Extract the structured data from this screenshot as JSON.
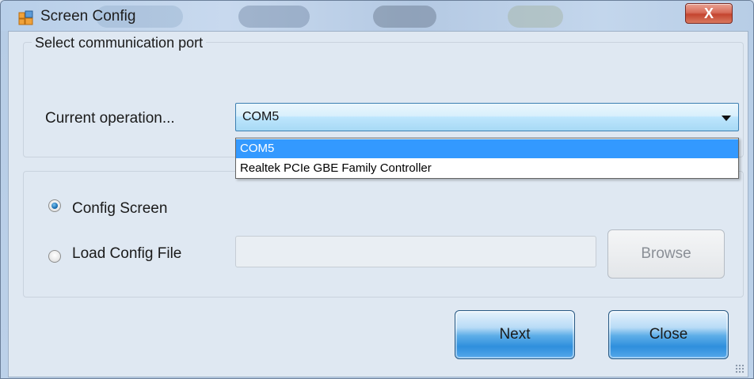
{
  "window": {
    "title": "Screen Config",
    "close_glyph": "X",
    "icon": "app-window-icon"
  },
  "port_group": {
    "legend": "Select communication port",
    "operation_label": "Current operation...",
    "selected_port": "COM5",
    "options": [
      "COM5",
      "Realtek PCIe GBE Family Controller"
    ]
  },
  "config_group": {
    "config_screen_label": "Config Screen",
    "config_screen_checked": true,
    "load_file_label": "Load Config File",
    "load_file_checked": false,
    "file_path": "",
    "browse_label": "Browse"
  },
  "footer": {
    "next_label": "Next",
    "close_label": "Close"
  },
  "colors": {
    "selection": "#3399ff",
    "close_button": "#c4452f",
    "primary_button": "#2f8fdd"
  }
}
